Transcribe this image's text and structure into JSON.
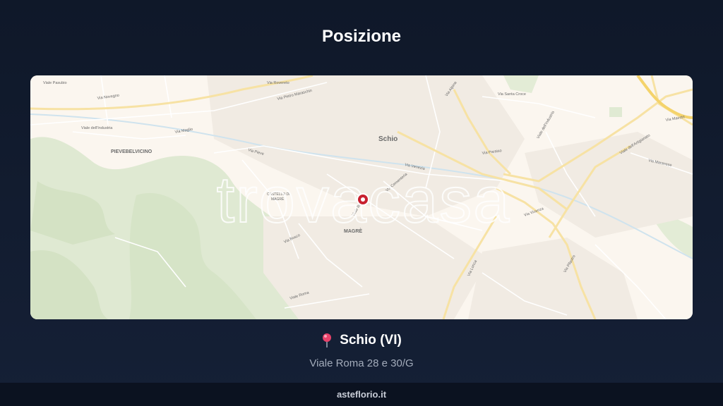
{
  "header": {
    "title": "Posizione"
  },
  "map": {
    "watermark": "trovacasa",
    "places": {
      "schio": "Schio",
      "pievebelvicino": "PIEVEBELVICINO",
      "magre": "MAGRÈ",
      "castello": "CASTELLO DI",
      "castello2": "MAGRÈ"
    },
    "streets": {
      "pasubio": "Viale Pasubio",
      "rovereto": "Via Rovereto",
      "maraschin": "Via Pietro Maraschin",
      "novegno": "Via Novegno",
      "dallindustria": "Viale dell'Industria",
      "maglio": "Via Maglio",
      "pieve": "Via Pieve",
      "venezia": "Via Venezia",
      "paraiso": "Via Paraiso",
      "santacroce": "Via Santa Croce",
      "industria2": "Viale dell'Industria",
      "artigianato": "Viale dell'Artigianato",
      "maranese": "Via Maranese",
      "vicenza": "Via Vicenza",
      "roma": "Viale Roma",
      "roma2": "Viale Roma",
      "bosco": "Via Bosco",
      "lonca": "Via Lonca",
      "pilastro": "Via Pilastro",
      "maestri": "Via Maestri",
      "cementeria": "Via Cementeria",
      "alpina": "Via Alpina"
    },
    "marker_color": "#c8202f"
  },
  "location": {
    "pin_icon": "pushpin-icon",
    "city": "Schio (VI)",
    "address": "Viale Roma 28 e 30/G"
  },
  "footer": {
    "site": "asteflorio.it"
  }
}
